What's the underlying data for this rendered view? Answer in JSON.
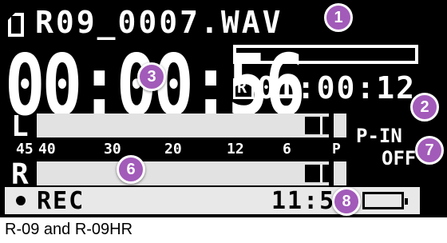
{
  "display": {
    "filename": "R09_0007.WAV",
    "elapsed_time": "00:00:56",
    "remaining_marker": "R",
    "remaining_time": "01:00:12",
    "channel_left": "L",
    "channel_right": "R",
    "meter_scale": [
      "45",
      "40",
      "30",
      "20",
      "12",
      "6",
      "P"
    ],
    "plugin_power_label": "P-IN",
    "plugin_power_value": "OFF",
    "status": "REC",
    "clock": "11:57",
    "icons": [
      "file-icon",
      "rec-dot-icon",
      "battery-icon"
    ]
  },
  "callouts": [
    "1",
    "2",
    "3",
    "6",
    "7",
    "8"
  ],
  "caption": "R-09 and R-09HR",
  "colors": {
    "lcd": "#000000",
    "lcd_text": "#ffffff",
    "callout": "#a25bb9"
  }
}
